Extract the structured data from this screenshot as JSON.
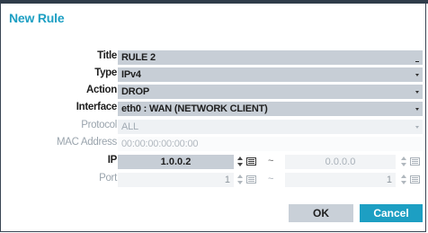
{
  "dialog": {
    "title": "New Rule"
  },
  "labels": {
    "title": "Title",
    "type": "Type",
    "action": "Action",
    "interface": "Interface",
    "protocol": "Protocol",
    "mac": "MAC Address",
    "ip": "IP",
    "port": "Port"
  },
  "fields": {
    "title_value": "RULE 2",
    "type_value": "IPv4",
    "action_value": "DROP",
    "interface_value": "eth0 : WAN (NETWORK CLIENT)",
    "protocol_value": "ALL",
    "mac_placeholder": "00:00:00:00:00:00",
    "ip_start": "1.0.0.2",
    "ip_end": "0.0.0.0",
    "port_start": "1",
    "port_end": "1",
    "range_separator": "~"
  },
  "buttons": {
    "ok": "OK",
    "cancel": "Cancel"
  },
  "colors": {
    "accent": "#1d9fc3",
    "field_dark": "#c7ced6",
    "field_light": "#eef1f4"
  }
}
